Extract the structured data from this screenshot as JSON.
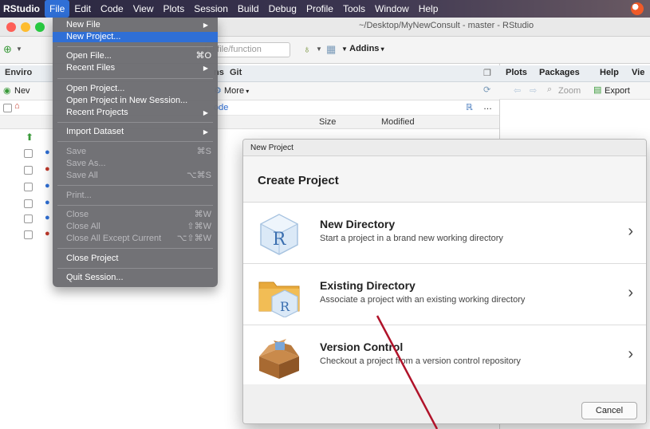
{
  "menubar": {
    "app": "RStudio",
    "items": [
      "File",
      "Edit",
      "Code",
      "View",
      "Plots",
      "Session",
      "Build",
      "Debug",
      "Profile",
      "Tools",
      "Window",
      "Help"
    ]
  },
  "window": {
    "title": "~/Desktop/MyNewConsult - master - RStudio"
  },
  "toolbar": {
    "goto_placeholder": "o file/function",
    "addins_label": "Addins"
  },
  "left_pane": {
    "tabs": [
      "Enviro",
      "ns",
      "Git"
    ],
    "toolbar_new": "Nev",
    "more_label": "More",
    "path_fragment": "ode",
    "columns": [
      "Size",
      "Modified"
    ]
  },
  "right_pane": {
    "tabs": [
      "Plots",
      "Packages",
      "Help",
      "Vie"
    ],
    "zoom_label": "Zoom",
    "export_label": "Export"
  },
  "file_menu": {
    "items": [
      {
        "label": "New File",
        "shortcut": "",
        "submenu": true,
        "disabled": false,
        "highlighted": false
      },
      {
        "label": "New Project...",
        "shortcut": "",
        "submenu": false,
        "disabled": false,
        "highlighted": true
      },
      {
        "label": "Open File...",
        "shortcut": "⌘O",
        "submenu": false,
        "disabled": false,
        "highlighted": false
      },
      {
        "label": "Recent Files",
        "shortcut": "",
        "submenu": true,
        "disabled": false,
        "highlighted": false
      },
      {
        "label": "Open Project...",
        "shortcut": "",
        "submenu": false,
        "disabled": false,
        "highlighted": false
      },
      {
        "label": "Open Project in New Session...",
        "shortcut": "",
        "submenu": false,
        "disabled": false,
        "highlighted": false
      },
      {
        "label": "Recent Projects",
        "shortcut": "",
        "submenu": true,
        "disabled": false,
        "highlighted": false
      },
      {
        "label": "Import Dataset",
        "shortcut": "",
        "submenu": true,
        "disabled": false,
        "highlighted": false
      },
      {
        "label": "Save",
        "shortcut": "⌘S",
        "submenu": false,
        "disabled": true,
        "highlighted": false
      },
      {
        "label": "Save As...",
        "shortcut": "",
        "submenu": false,
        "disabled": true,
        "highlighted": false
      },
      {
        "label": "Save All",
        "shortcut": "⌥⌘S",
        "submenu": false,
        "disabled": true,
        "highlighted": false
      },
      {
        "label": "Print...",
        "shortcut": "",
        "submenu": false,
        "disabled": true,
        "highlighted": false
      },
      {
        "label": "Close",
        "shortcut": "⌘W",
        "submenu": false,
        "disabled": true,
        "highlighted": false
      },
      {
        "label": "Close All",
        "shortcut": "⇧⌘W",
        "submenu": false,
        "disabled": true,
        "highlighted": false
      },
      {
        "label": "Close All Except Current",
        "shortcut": "⌥⇧⌘W",
        "submenu": false,
        "disabled": true,
        "highlighted": false
      },
      {
        "label": "Close Project",
        "shortcut": "",
        "submenu": false,
        "disabled": false,
        "highlighted": false
      },
      {
        "label": "Quit Session...",
        "shortcut": "",
        "submenu": false,
        "disabled": false,
        "highlighted": false
      }
    ]
  },
  "dialog": {
    "window_title": "New Project",
    "heading": "Create Project",
    "options": [
      {
        "title": "New Directory",
        "description": "Start a project in a brand new working directory",
        "icon": "r-cube-icon"
      },
      {
        "title": "Existing Directory",
        "description": "Associate a project with an existing working directory",
        "icon": "folder-r-icon"
      },
      {
        "title": "Version Control",
        "description": "Checkout a project from a version control repository",
        "icon": "cardboard-box-icon"
      }
    ],
    "cancel_label": "Cancel"
  },
  "colors": {
    "menu_highlight": "#2f6fd6",
    "menu_bg": "#6c6c70",
    "annotation_arrow": "#b0132a"
  }
}
